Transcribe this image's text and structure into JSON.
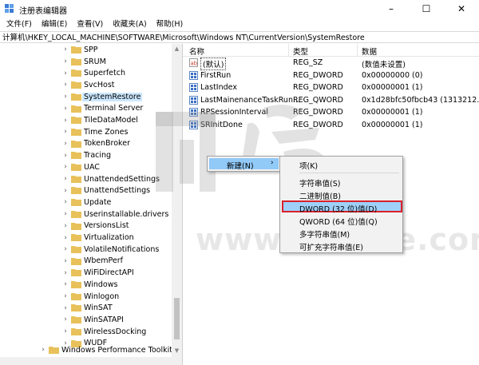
{
  "window": {
    "title": "注册表编辑器",
    "minimize_glyph": "–",
    "maximize_glyph": "☐",
    "close_glyph": "✕"
  },
  "menu": [
    "文件(F)",
    "编辑(E)",
    "查看(V)",
    "收藏夹(A)",
    "帮助(H)"
  ],
  "address": "计算机\\HKEY_LOCAL_MACHINE\\SOFTWARE\\Microsoft\\Windows NT\\CurrentVersion\\SystemRestore",
  "tree": {
    "items": [
      {
        "label": "SPP",
        "selected": false
      },
      {
        "label": "SRUM",
        "selected": false
      },
      {
        "label": "Superfetch",
        "selected": false
      },
      {
        "label": "SvcHost",
        "selected": false
      },
      {
        "label": "SystemRestore",
        "selected": true
      },
      {
        "label": "Terminal Server",
        "selected": false
      },
      {
        "label": "TileDataModel",
        "selected": false
      },
      {
        "label": "Time Zones",
        "selected": false
      },
      {
        "label": "TokenBroker",
        "selected": false
      },
      {
        "label": "Tracing",
        "selected": false
      },
      {
        "label": "UAC",
        "selected": false
      },
      {
        "label": "UnattendedSettings",
        "selected": false
      },
      {
        "label": "UnattendSettings",
        "selected": false
      },
      {
        "label": "Update",
        "selected": false
      },
      {
        "label": "Userinstallable.drivers",
        "selected": false
      },
      {
        "label": "VersionsList",
        "selected": false
      },
      {
        "label": "Virtualization",
        "selected": false
      },
      {
        "label": "VolatileNotifications",
        "selected": false
      },
      {
        "label": "WbemPerf",
        "selected": false
      },
      {
        "label": "WiFiDirectAPI",
        "selected": false
      },
      {
        "label": "Windows",
        "selected": false
      },
      {
        "label": "Winlogon",
        "selected": false
      },
      {
        "label": "WinSAT",
        "selected": false
      },
      {
        "label": "WinSATAPI",
        "selected": false
      },
      {
        "label": "WirelessDocking",
        "selected": false
      },
      {
        "label": "WUDF",
        "selected": false
      }
    ],
    "parent_item": "Windows Performance Toolkit"
  },
  "list": {
    "headers": {
      "name": "名称",
      "type": "类型",
      "data": "数据"
    },
    "rows": [
      {
        "name": "(默认)",
        "type": "REG_SZ",
        "data": "(数值未设置)",
        "icon": "string-value-icon"
      },
      {
        "name": "FirstRun",
        "type": "REG_DWORD",
        "data": "0x00000000 (0)",
        "icon": "binary-value-icon"
      },
      {
        "name": "LastIndex",
        "type": "REG_DWORD",
        "data": "0x00000001 (1)",
        "icon": "binary-value-icon"
      },
      {
        "name": "LastMainenanceTaskRun...",
        "type": "REG_QWORD",
        "data": "0x1d28bfc50fbcb43 (1313212...",
        "icon": "binary-value-icon"
      },
      {
        "name": "RPSessionInterval",
        "type": "REG_DWORD",
        "data": "0x00000001 (1)",
        "icon": "binary-value-icon"
      },
      {
        "name": "SRInitDone",
        "type": "REG_DWORD",
        "data": "0x00000001 (1)",
        "icon": "binary-value-icon"
      }
    ]
  },
  "context_menu": {
    "new_label": "新建(N)",
    "arrow": "›"
  },
  "submenu": {
    "key": "项(K)",
    "string": "字符串值(S)",
    "binary": "二进制值(B)",
    "dword": "DWORD (32 位)值(D)",
    "qword": "QWORD (64 位)值(Q)",
    "multi_string": "多字符串值(M)",
    "expandable_string": "可扩充字符串值(E)"
  },
  "watermark": "www.ithome.com",
  "colors": {
    "selection": "#cce8ff",
    "menu_highlight": "#91c9f7",
    "red_box": "#d9202a",
    "folder": "#e8c15a"
  }
}
